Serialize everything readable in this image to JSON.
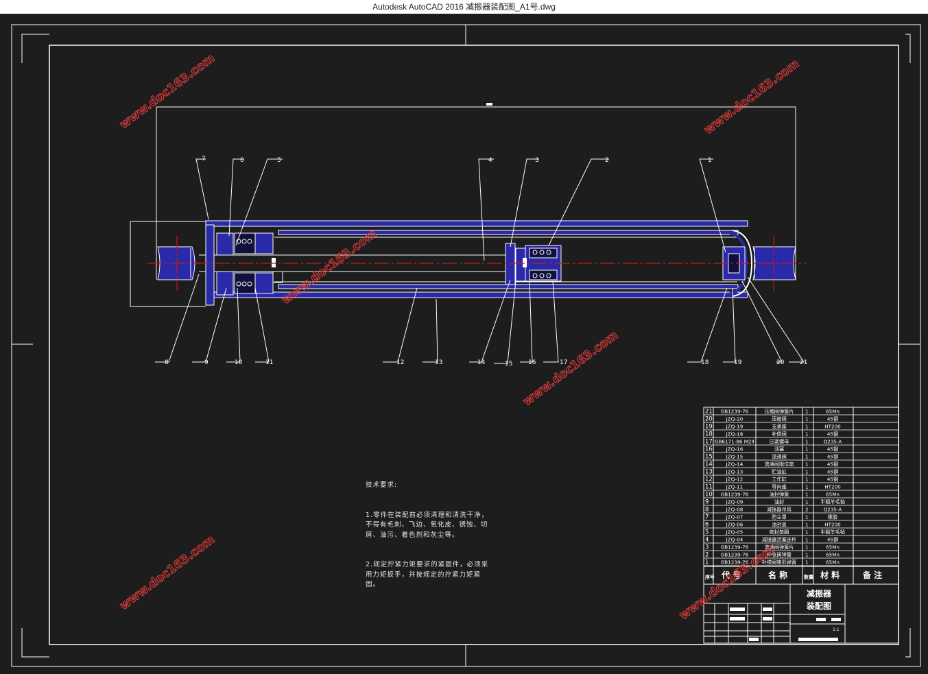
{
  "app": {
    "window_title": "Autodesk AutoCAD 2016     减振器装配图_A1号.dwg"
  },
  "colors": {
    "background": "#1d1d1d",
    "line": "#ffffff",
    "part_fill": "#2a2aa8",
    "centerline": "#d01515",
    "watermark": "#d83a3a"
  },
  "watermark_text": "www.doc163.com",
  "top_labels": [
    "7",
    "6",
    "5",
    "4",
    "3",
    "2",
    "1"
  ],
  "bottom_labels": [
    "8",
    "9",
    "10",
    "11",
    "12",
    "13",
    "14",
    "15",
    "16",
    "17",
    "18",
    "19",
    "20",
    "21"
  ],
  "tech_requirements": {
    "heading": "技术要求:",
    "items": [
      "1.零件在装配前必须清理和清洗干净，不得有毛刺、飞边、氧化皮、锈蚀、切屑、油污、着色剂和灰尘等。",
      "2.规定拧紧力矩要求的紧固件，必须采用力矩扳手，并按规定的拧紧力矩紧固。"
    ]
  },
  "bom": {
    "rows": [
      {
        "no": "21",
        "code": "GB1239-76",
        "name": "压缩阀弹簧片",
        "qty": "1",
        "material": "65Mn"
      },
      {
        "no": "20",
        "code": "JZQ-20",
        "name": "压缩阀",
        "qty": "1",
        "material": "45钢"
      },
      {
        "no": "19",
        "code": "JZQ-19",
        "name": "支承座",
        "qty": "1",
        "material": "HT200"
      },
      {
        "no": "18",
        "code": "JZQ-18",
        "name": "补偿阀",
        "qty": "1",
        "material": "45钢"
      },
      {
        "no": "17",
        "code": "GB6171-86 M24",
        "name": "压紧螺母",
        "qty": "1",
        "material": "Q235-A"
      },
      {
        "no": "16",
        "code": "JZQ-16",
        "name": "活塞",
        "qty": "1",
        "material": "45钢"
      },
      {
        "no": "15",
        "code": "JZQ-15",
        "name": "流通阀",
        "qty": "1",
        "material": "45钢"
      },
      {
        "no": "14",
        "code": "JZQ-14",
        "name": "流通阀限位座",
        "qty": "1",
        "material": "45钢"
      },
      {
        "no": "13",
        "code": "JZQ-13",
        "name": "贮油缸",
        "qty": "1",
        "material": "45钢"
      },
      {
        "no": "12",
        "code": "JZQ-12",
        "name": "工作缸",
        "qty": "1",
        "material": "45钢"
      },
      {
        "no": "11",
        "code": "JZQ-11",
        "name": "导向座",
        "qty": "1",
        "material": "HT200"
      },
      {
        "no": "10",
        "code": "GB1239-76",
        "name": "油封弹簧",
        "qty": "1",
        "material": "65Mn"
      },
      {
        "no": "9",
        "code": "JZQ-09",
        "name": "油封",
        "qty": "1",
        "material": "半粗羊毛毡"
      },
      {
        "no": "8",
        "code": "JZQ-08",
        "name": "减振器吊耳",
        "qty": "2",
        "material": "Q235-A"
      },
      {
        "no": "7",
        "code": "JZQ-07",
        "name": "防尘罩",
        "qty": "1",
        "material": "橡胶"
      },
      {
        "no": "6",
        "code": "JZQ-06",
        "name": "油封盖",
        "qty": "1",
        "material": "HT200"
      },
      {
        "no": "5",
        "code": "JZQ-05",
        "name": "密封垫圈",
        "qty": "1",
        "material": "半粗羊毛毡"
      },
      {
        "no": "4",
        "code": "JZQ-04",
        "name": "减振器活塞连杆",
        "qty": "1",
        "material": "45钢"
      },
      {
        "no": "3",
        "code": "GB1239-76",
        "name": "流通阀弹簧片",
        "qty": "1",
        "material": "65Mn"
      },
      {
        "no": "2",
        "code": "GB1239-76",
        "name": "伸张阀弹簧",
        "qty": "1",
        "material": "65Mn"
      },
      {
        "no": "1",
        "code": "GB1239-76",
        "name": "补偿阀锥形弹簧",
        "qty": "1",
        "material": "65Mn"
      }
    ],
    "header": {
      "no": "序号",
      "code": "代 号",
      "name": "名 称",
      "qty": "数量",
      "material": "材 料",
      "remark": "备 注"
    }
  },
  "title_block": {
    "drawing_name_line1": "减振器",
    "drawing_name_line2": "装配图",
    "scale": "1:1"
  }
}
